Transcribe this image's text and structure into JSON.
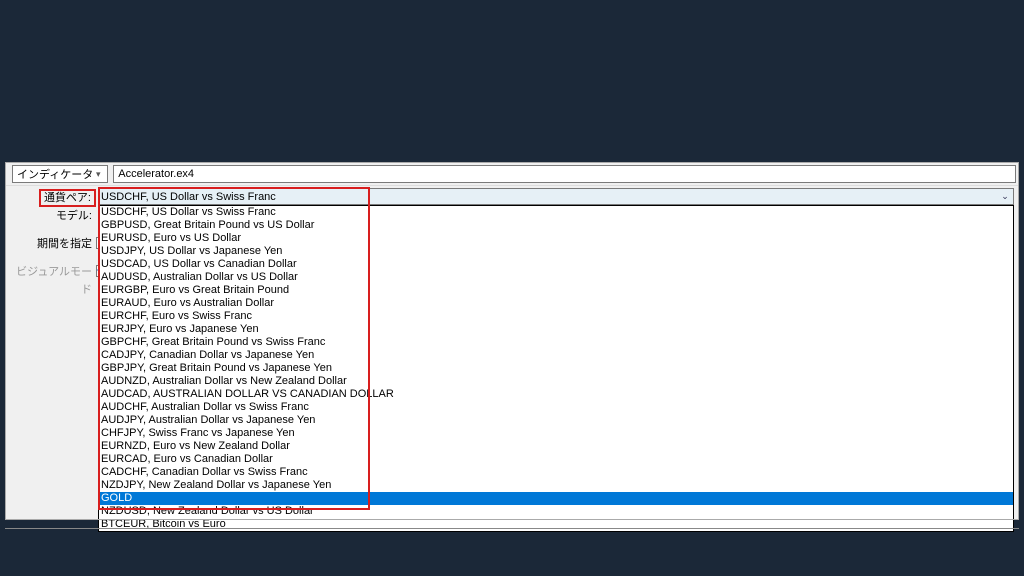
{
  "top": {
    "indicator_label": "インディケータ",
    "indicator_value": "Accelerator.ex4"
  },
  "labels": {
    "pair": "通貨ペア:",
    "model": "モデル:",
    "period": "期間を指定",
    "visual": "ビジュアルモード"
  },
  "checks": {
    "period": false,
    "visual": true
  },
  "pair_combo": {
    "selected": "USDCHF, US Dollar vs Swiss Franc"
  },
  "options": [
    {
      "text": "USDCHF, US Dollar vs Swiss Franc"
    },
    {
      "text": "GBPUSD, Great Britain Pound vs US Dollar"
    },
    {
      "text": "EURUSD, Euro vs US Dollar"
    },
    {
      "text": "USDJPY, US Dollar vs Japanese Yen"
    },
    {
      "text": "USDCAD, US Dollar vs Canadian Dollar"
    },
    {
      "text": "AUDUSD, Australian Dollar vs US Dollar"
    },
    {
      "text": "EURGBP, Euro vs Great Britain Pound"
    },
    {
      "text": "EURAUD, Euro vs Australian Dollar"
    },
    {
      "text": "EURCHF, Euro vs Swiss Franc"
    },
    {
      "text": "EURJPY, Euro vs Japanese Yen"
    },
    {
      "text": "GBPCHF, Great Britain Pound vs Swiss Franc"
    },
    {
      "text": "CADJPY, Canadian Dollar vs Japanese Yen"
    },
    {
      "text": "GBPJPY, Great Britain Pound vs Japanese Yen"
    },
    {
      "text": "AUDNZD, Australian Dollar vs New Zealand Dollar"
    },
    {
      "text": "AUDCAD, AUSTRALIAN DOLLAR VS CANADIAN DOLLAR"
    },
    {
      "text": "AUDCHF, Australian Dollar vs Swiss Franc"
    },
    {
      "text": "AUDJPY, Australian Dollar vs Japanese Yen"
    },
    {
      "text": "CHFJPY, Swiss Franc vs Japanese Yen"
    },
    {
      "text": "EURNZD, Euro vs New Zealand Dollar"
    },
    {
      "text": "EURCAD, Euro vs Canadian Dollar"
    },
    {
      "text": "CADCHF, Canadian Dollar vs Swiss Franc"
    },
    {
      "text": "NZDJPY, New Zealand Dollar vs Japanese Yen"
    },
    {
      "text": "GOLD",
      "selected": true
    },
    {
      "text": "NZDUSD, New Zealand Dollar vs US Dollar"
    },
    {
      "text": "BTCEUR, Bitcoin vs Euro"
    }
  ]
}
